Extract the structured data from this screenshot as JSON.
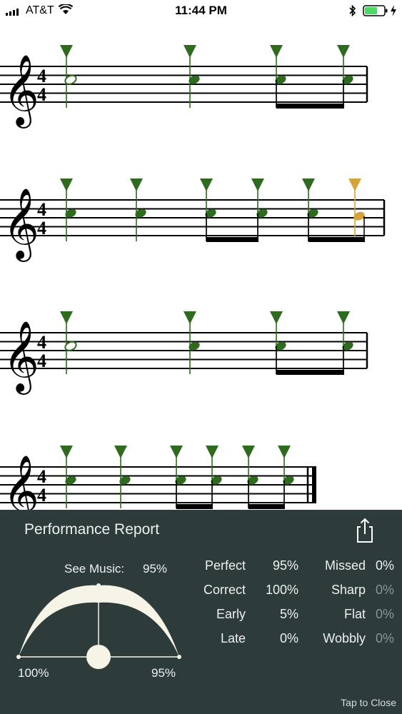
{
  "status_bar": {
    "carrier": "AT&T",
    "time": "11:44 PM"
  },
  "score": {
    "time_signature": [
      "4",
      "4"
    ],
    "colors": {
      "correct": "#2e6b1e",
      "late": "#d4a33a",
      "staff": "#000000"
    },
    "systems": [
      {
        "marks": [
          "correct",
          "correct",
          "correct",
          "correct"
        ]
      },
      {
        "marks": [
          "correct",
          "correct",
          "correct",
          "correct",
          "correct",
          "late"
        ]
      },
      {
        "marks": [
          "correct",
          "correct",
          "correct",
          "correct"
        ]
      },
      {
        "marks": [
          "correct",
          "correct",
          "correct",
          "correct",
          "correct",
          "correct"
        ]
      }
    ]
  },
  "report": {
    "title": "Performance Report",
    "see_music_label": "See Music:",
    "see_music_value": "95%",
    "gauge_left_label": "100%",
    "gauge_right_label": "95%",
    "stats_left": [
      {
        "label": "Perfect",
        "value": "95%"
      },
      {
        "label": "Correct",
        "value": "100%"
      },
      {
        "label": "Early",
        "value": "5%"
      },
      {
        "label": "Late",
        "value": "0%"
      }
    ],
    "stats_right": [
      {
        "label": "Missed",
        "value": "0%"
      },
      {
        "label": "Sharp",
        "value": "0%"
      },
      {
        "label": "Flat",
        "value": "0%"
      },
      {
        "label": "Wobbly",
        "value": "0%"
      }
    ],
    "tap_to_close": "Tap to Close"
  }
}
